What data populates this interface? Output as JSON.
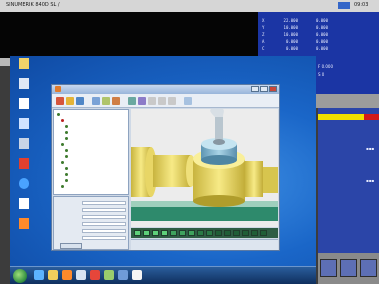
{
  "cnc": {
    "header": {
      "left_text": "SINUMERIK  840D SL  /",
      "right_text": "09:03"
    },
    "position": [
      {
        "axis": "X",
        "value": "22.000",
        "dist": "0.000"
      },
      {
        "axis": "Y",
        "value": "10.000",
        "dist": "0.000"
      },
      {
        "axis": "Z",
        "value": "10.000",
        "dist": "0.000"
      },
      {
        "axis": "A",
        "value": "0.000",
        "dist": "0.000"
      },
      {
        "axis": "C",
        "value": "0.000",
        "dist": "0.000"
      }
    ],
    "feed_label": "F 0.000",
    "spindle_label": "S 0",
    "colors": {
      "position_panel": "#1b35a4",
      "warning": "#f0e000",
      "alarm": "#d21a1a"
    }
  },
  "desktop": {
    "icons": [
      {
        "name": "folder-icon",
        "label": "",
        "color": "#f2d36a"
      },
      {
        "name": "recycle-bin-icon",
        "label": "",
        "color": "#dfe8f5"
      },
      {
        "name": "document-icon",
        "label": "",
        "color": "#ffffff"
      },
      {
        "name": "network-icon",
        "label": "",
        "color": "#cfe2ff"
      },
      {
        "name": "app-icon",
        "label": "",
        "color": "#c8d4e6"
      },
      {
        "name": "cam-shortcut-icon",
        "label": "",
        "color": "#e0402e"
      },
      {
        "name": "ie-icon",
        "label": "",
        "color": "#4aa3ff"
      },
      {
        "name": "settings-icon",
        "label": "",
        "color": "#ffffff"
      },
      {
        "name": "program-icon",
        "label": "",
        "color": "#ff8a2b"
      }
    ]
  },
  "taskbar": {
    "items": [
      {
        "name": "taskbar-ie-icon",
        "color": "#5cb3ff"
      },
      {
        "name": "taskbar-explorer-icon",
        "color": "#f2cf5c"
      },
      {
        "name": "taskbar-media-icon",
        "color": "#ff8a2b"
      },
      {
        "name": "taskbar-app1-icon",
        "color": "#d9e4f2"
      },
      {
        "name": "taskbar-app2-icon",
        "color": "#e6463a"
      },
      {
        "name": "taskbar-app3-icon",
        "color": "#9acd6c"
      },
      {
        "name": "taskbar-app4-icon",
        "color": "#6f9bd8"
      },
      {
        "name": "taskbar-app5-icon",
        "color": "#f4f4f4"
      }
    ],
    "clock": ""
  },
  "cam_window": {
    "title": "",
    "tree_nodes": [
      {
        "label": "",
        "selected": false
      },
      {
        "label": "",
        "selected": true
      },
      {
        "label": "",
        "selected": false
      },
      {
        "label": "",
        "selected": false
      },
      {
        "label": "",
        "selected": false
      },
      {
        "label": "",
        "selected": false
      },
      {
        "label": "",
        "selected": false
      },
      {
        "label": "",
        "selected": false
      },
      {
        "label": "",
        "selected": false
      },
      {
        "label": "",
        "selected": false
      },
      {
        "label": "",
        "selected": false
      },
      {
        "label": "",
        "selected": false
      },
      {
        "label": "",
        "selected": false
      }
    ],
    "properties": [
      {
        "key": "",
        "value": ""
      },
      {
        "key": "",
        "value": ""
      },
      {
        "key": "",
        "value": ""
      },
      {
        "key": "",
        "value": ""
      },
      {
        "key": "",
        "value": ""
      },
      {
        "key": "",
        "value": ""
      }
    ],
    "ok_label": "",
    "model_colors": {
      "part": "#f2df6a",
      "part_shade": "#c8b43f",
      "fixture": "#7fb6cf",
      "tool": "#b9c6cf",
      "table": "#2e8a6c"
    }
  }
}
